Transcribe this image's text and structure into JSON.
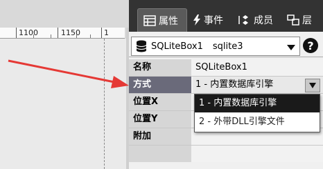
{
  "ruler": {
    "marks": [
      "1100",
      "1150",
      "1"
    ]
  },
  "tabs": [
    {
      "label": "属性",
      "icon": "properties-icon"
    },
    {
      "label": "事件",
      "icon": "lightning-icon"
    },
    {
      "label": "成员",
      "icon": "members-icon"
    },
    {
      "label": "层",
      "icon": "layers-icon"
    }
  ],
  "component": {
    "name": "SQLiteBox1",
    "type": "sqlite3",
    "icon": "database-icon"
  },
  "help_label": "?",
  "properties": [
    {
      "name": "名称",
      "value": "SQLiteBox1"
    },
    {
      "name": "方式",
      "value": "1 - 内置数据库引擎"
    },
    {
      "name": "位置X",
      "value": ""
    },
    {
      "name": "位置Y",
      "value": ""
    },
    {
      "name": "附加",
      "value": ""
    }
  ],
  "dropdown_options": [
    "1 - 内置数据库引擎",
    "2 - 外带DLL引擎文件"
  ],
  "colors": {
    "annotation_arrow": "#e53935",
    "tab_bar": "#333333",
    "selected_name": "#6a6a7a"
  }
}
